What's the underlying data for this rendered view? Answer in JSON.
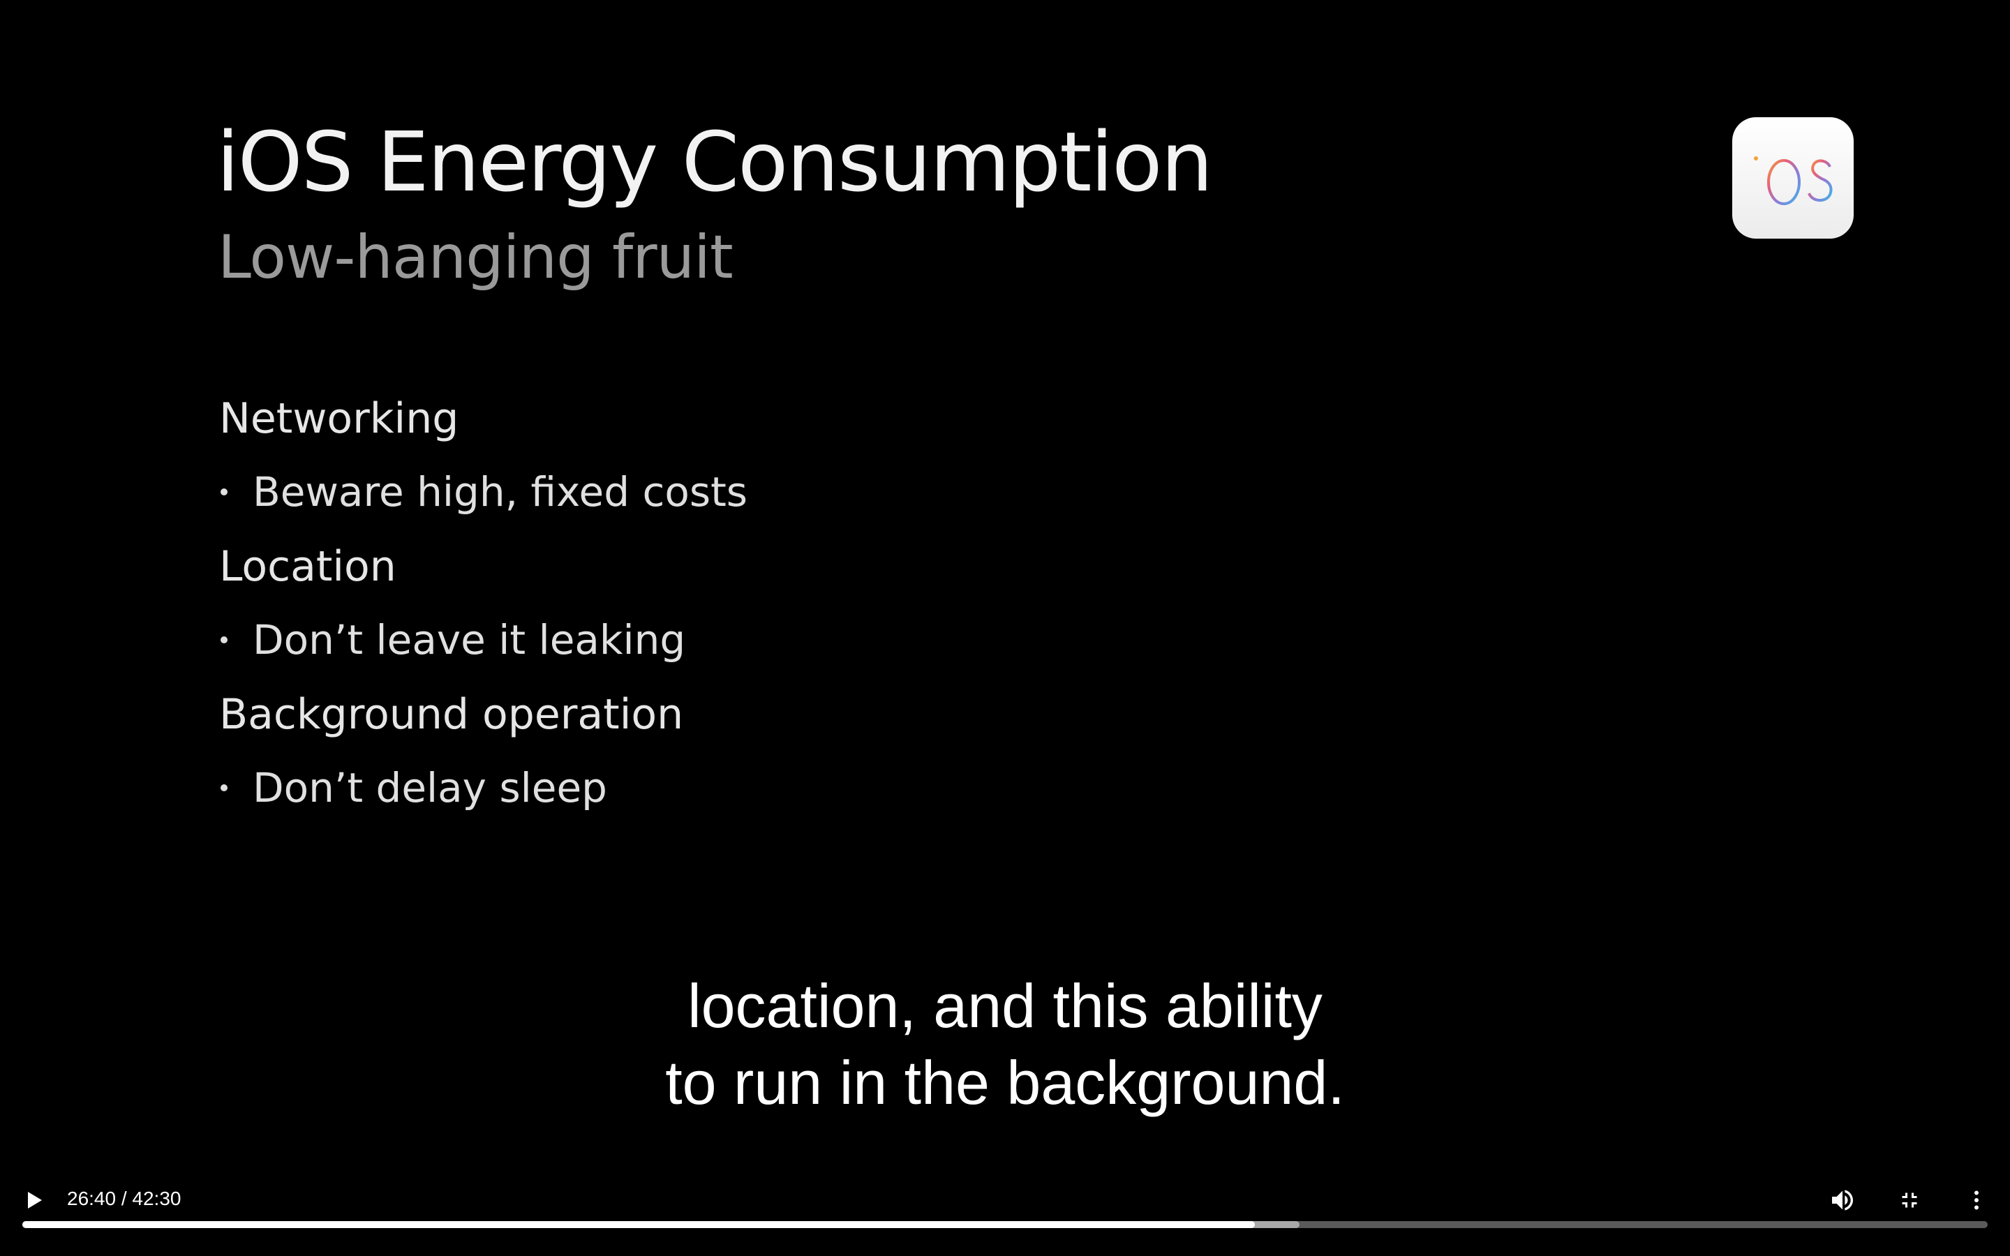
{
  "slide": {
    "title": "iOS Energy Consumption",
    "subtitle": "Low-hanging fruit",
    "sections": [
      {
        "heading": "Networking",
        "bullet": "Beware high, fixed costs"
      },
      {
        "heading": "Location",
        "bullet": "Don’t leave it leaking"
      },
      {
        "heading": "Background operation",
        "bullet": "Don’t delay sleep"
      }
    ],
    "logo_text": "iOS"
  },
  "captions": {
    "line1": "location, and this ability",
    "line2": "to run in the background."
  },
  "player": {
    "time_display": "26:40 / 42:30",
    "current_time": "26:40",
    "duration": "42:30",
    "played_fraction": 0.627,
    "buffered_fraction": 0.65,
    "state": "paused",
    "icons": {
      "play": "play-icon",
      "volume": "volume-icon",
      "fullscreen_exit": "fullscreen-exit-icon",
      "more": "more-vert-icon"
    }
  }
}
